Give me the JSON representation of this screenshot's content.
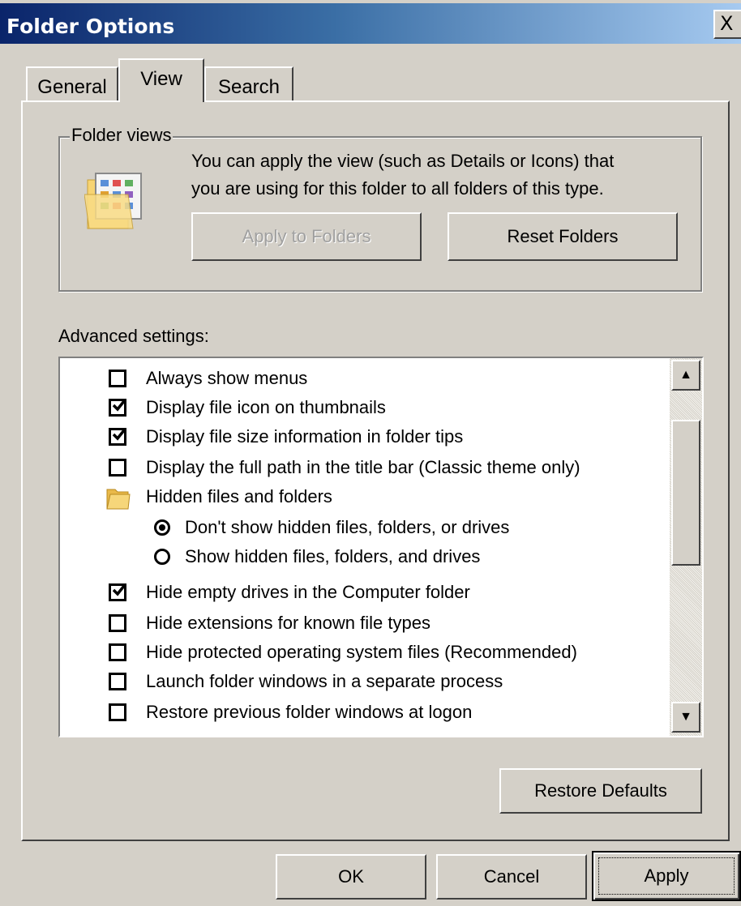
{
  "window": {
    "title": "Folder Options",
    "close_glyph": "X"
  },
  "tabs": [
    {
      "label": "General",
      "active": false
    },
    {
      "label": "View",
      "active": true
    },
    {
      "label": "Search",
      "active": false
    }
  ],
  "folder_views": {
    "group_label": "Folder views",
    "description_line1": "You can apply the view (such as Details or Icons) that",
    "description_line2": "you are using for this folder to all folders of this type.",
    "apply_button": "Apply to Folders",
    "reset_button": "Reset Folders",
    "icon": "folder-view-icon"
  },
  "advanced": {
    "label": "Advanced settings:",
    "items": [
      {
        "type": "checkbox",
        "label": "Always show menus",
        "checked": false
      },
      {
        "type": "checkbox",
        "label": "Display file icon on thumbnails",
        "checked": true
      },
      {
        "type": "checkbox",
        "label": "Display file size information in folder tips",
        "checked": true
      },
      {
        "type": "checkbox",
        "label": "Display the full path in the title bar (Classic theme only)",
        "checked": false
      },
      {
        "type": "folder",
        "label": "Hidden files and folders",
        "icon": "folder-icon"
      },
      {
        "type": "radio",
        "label": "Don't show hidden files, folders, or drives",
        "checked": true
      },
      {
        "type": "radio",
        "label": "Show hidden files, folders, and drives",
        "checked": false
      },
      {
        "type": "checkbox",
        "label": "Hide empty drives in the Computer folder",
        "checked": true
      },
      {
        "type": "checkbox",
        "label": "Hide extensions for known file types",
        "checked": false
      },
      {
        "type": "checkbox",
        "label": "Hide protected operating system files (Recommended)",
        "checked": false
      },
      {
        "type": "checkbox",
        "label": "Launch folder windows in a separate process",
        "checked": false
      },
      {
        "type": "checkbox",
        "label": "Restore previous folder windows at logon",
        "checked": false
      }
    ],
    "restore_defaults": "Restore Defaults"
  },
  "footer": {
    "ok": "OK",
    "cancel": "Cancel",
    "apply": "Apply"
  },
  "colors": {
    "face": "#d4d0c8",
    "title_start": "#0a246a",
    "title_end": "#a6caf0"
  }
}
